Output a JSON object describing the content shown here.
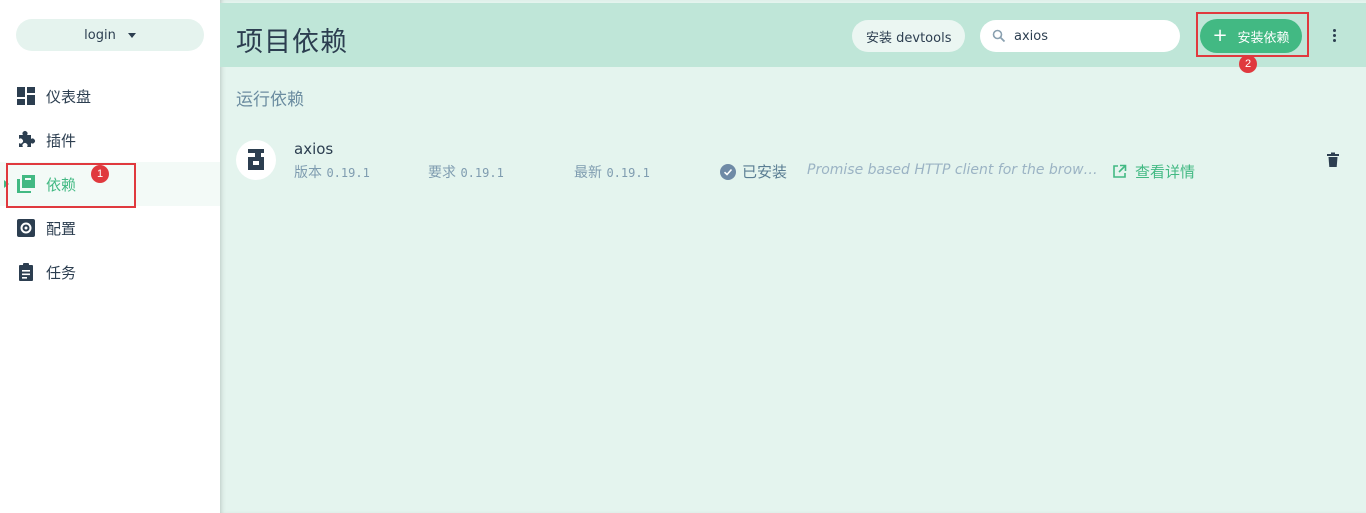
{
  "sidebar": {
    "project_name": "login",
    "items": [
      {
        "label": "仪表盘",
        "icon": "dashboard-icon"
      },
      {
        "label": "插件",
        "icon": "puzzle-icon"
      },
      {
        "label": "依赖",
        "icon": "library-icon",
        "active": true
      },
      {
        "label": "配置",
        "icon": "gear-icon"
      },
      {
        "label": "任务",
        "icon": "clipboard-icon"
      }
    ]
  },
  "header": {
    "title": "项目依赖",
    "devtools_label": "安装 devtools",
    "search_value": "axios",
    "install_label": "安装依赖"
  },
  "section": {
    "title": "运行依赖"
  },
  "dependency": {
    "name": "axios",
    "version_label": "版本",
    "version": "0.19.1",
    "required_label": "要求",
    "required": "0.19.1",
    "latest_label": "最新",
    "latest": "0.19.1",
    "status": "已安装",
    "description": "Promise based HTTP client for the browser and node.js",
    "details_label": "查看详情"
  },
  "annotations": {
    "badge1": "1",
    "badge2": "2"
  },
  "colors": {
    "accent": "#42b983",
    "header_bg": "#bfe6d8",
    "main_bg": "#e4f4ee",
    "highlight": "#e0393e"
  }
}
